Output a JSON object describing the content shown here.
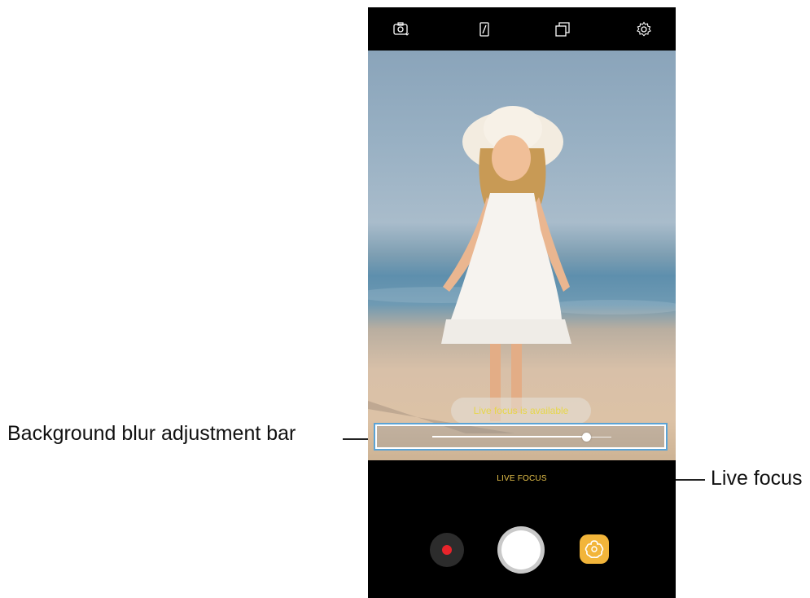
{
  "topbar": {
    "icons": [
      "switch-camera-icon",
      "flash-icon",
      "ratio-icon",
      "settings-icon"
    ]
  },
  "viewfinder": {
    "toast_text": "Live focus is available",
    "blur_level": 0.86
  },
  "bottom": {
    "mode_label": "LIVE FOCUS",
    "buttons": [
      "record-icon",
      "shutter",
      "effects-icon"
    ]
  },
  "annotations": {
    "blur_bar": "Background blur adjustment bar",
    "live_focus": "Live focus"
  },
  "colors": {
    "toast_text": "#e6d64a",
    "mode_label": "#e8c34a",
    "record_dot": "#e8242b",
    "effects_button": "#f2b53a",
    "highlight_border": "#5aa3d6"
  }
}
